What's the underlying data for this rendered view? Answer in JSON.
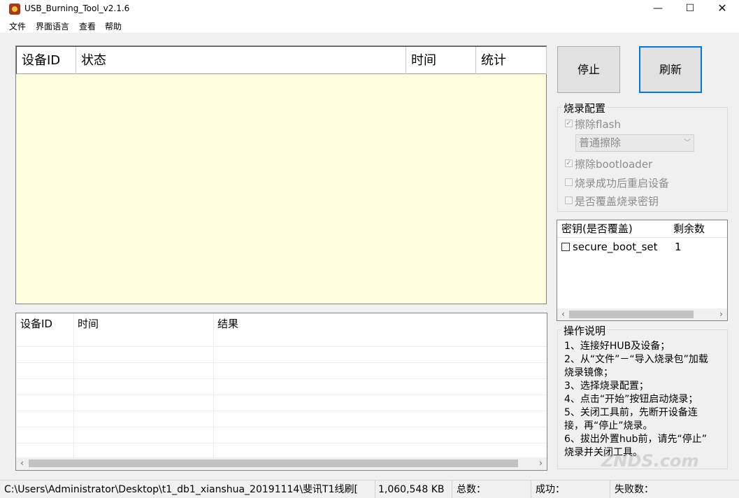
{
  "window": {
    "title": "USB_Burning_Tool_v2.1.6",
    "minimize": "—",
    "maximize": "☐",
    "close": "✕"
  },
  "menu": [
    "文件",
    "界面语言",
    "查看",
    "帮助"
  ],
  "device_table": {
    "headers": [
      "设备ID",
      "状态",
      "时间",
      "统计"
    ]
  },
  "buttons": {
    "stop": "停止",
    "refresh": "刷新"
  },
  "burn_config": {
    "title": "烧录配置",
    "erase_flash": {
      "label": "擦除flash",
      "checked": true
    },
    "erase_mode": "普通擦除",
    "erase_bootloader": {
      "label": "擦除bootloader",
      "checked": true
    },
    "reboot_after": {
      "label": "烧录成功后重启设备",
      "checked": false
    },
    "overwrite_key": {
      "label": "是否覆盖烧录密钥",
      "checked": false
    }
  },
  "key_list": {
    "headers": [
      "密钥(是否覆盖)",
      "剩余数"
    ],
    "rows": [
      {
        "name": "secure_boot_set",
        "remaining": "1",
        "checked": false
      }
    ]
  },
  "instructions": {
    "title": "操作说明",
    "lines": [
      "1、连接好HUB及设备；",
      "2、从“文件”－“导入烧录包”加载",
      "烧录镜像；",
      "3、选择烧录配置；",
      "4、点击“开始”按钮启动烧录；",
      "5、关闭工具前，先断开设备连",
      "接，再“停止”烧录。",
      "6、拔出外置hub前，请先“停止”",
      "烧录并关闭工具。"
    ]
  },
  "log_table": {
    "headers": [
      "设备ID",
      "时间",
      "结果"
    ]
  },
  "status": {
    "path": "C:\\Users\\Administrator\\Desktop\\t1_db1_xianshua_20191114\\斐讯T1线刷[",
    "size": "1,060,548 KB",
    "total": "总数：",
    "success": "成功：",
    "failed": "失败数："
  },
  "watermark": "ZNDS.com"
}
